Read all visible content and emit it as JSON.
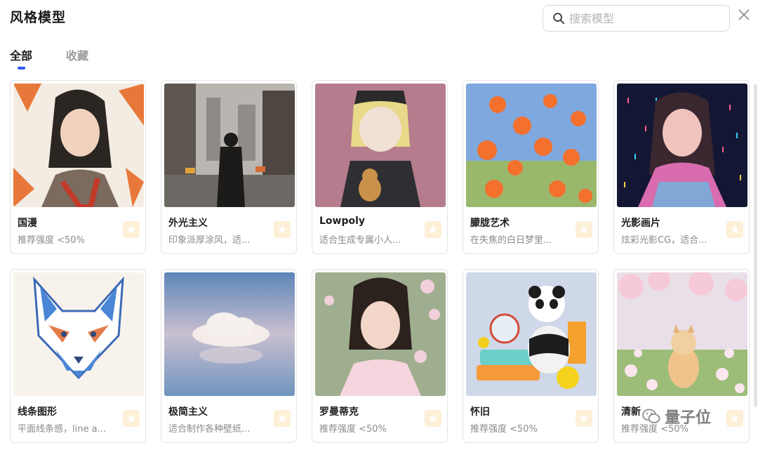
{
  "header": {
    "title": "风格模型",
    "search_placeholder": "搜索模型"
  },
  "tabs": [
    {
      "label": "全部",
      "active": true
    },
    {
      "label": "收藏",
      "active": false
    }
  ],
  "cards": [
    {
      "name": "国漫",
      "desc": "推荐强度 <50%"
    },
    {
      "name": "外光主义",
      "desc": "印象派厚涂风，适..."
    },
    {
      "name": "Lowpoly",
      "desc": "适合生成专属小人..."
    },
    {
      "name": "朦胧艺术",
      "desc": "在失焦的白日梦里..."
    },
    {
      "name": "光影画片",
      "desc": "炫彩光影CG，适合..."
    },
    {
      "name": "线条图形",
      "desc": "平面线条感，line a..."
    },
    {
      "name": "极简主义",
      "desc": "适合制作各种壁纸..."
    },
    {
      "name": "罗曼蒂克",
      "desc": "推荐强度 <50%"
    },
    {
      "name": "怀旧",
      "desc": "推荐强度 <50%"
    },
    {
      "name": "清新",
      "desc": "推荐强度 <50%"
    }
  ],
  "watermark": "量子位",
  "colors": {
    "accent": "#2f54eb",
    "favorite_bg": "#fdf0d7",
    "favorite_star": "#ffffff"
  },
  "icons": {
    "search": "search-icon",
    "close": "close-icon",
    "favorite": "star-icon"
  }
}
